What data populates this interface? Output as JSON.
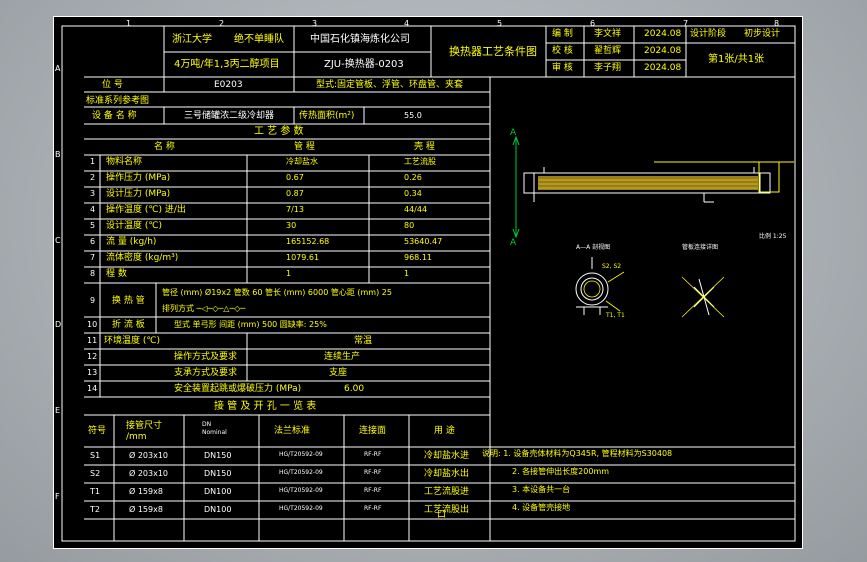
{
  "title_block": {
    "org": "浙江大学",
    "team": "绝不单睡队",
    "company": "中国石化镇海炼化公司",
    "project": "4万吨/年1,3丙二醇项目",
    "drawing_no": "ZJU-换热器-0203",
    "drawing_title": "换热器工艺条件图",
    "rows": [
      {
        "role": "编  制",
        "name": "李文祥",
        "date": "2024.08"
      },
      {
        "role": "校  核",
        "name": "翟哲辉",
        "date": "2024.08"
      },
      {
        "role": "审  核",
        "name": "李子翔",
        "date": "2024.08"
      }
    ],
    "stage_label": "设计阶段",
    "stage_value": "初步设计",
    "sheet_info": "第1张/共1张"
  },
  "equipment": {
    "tag_label": "位  号",
    "tag": "E0203",
    "type": "型式:固定管板、浮管、环盘管、夹套",
    "standard": "标准系列参考图",
    "name_label": "设 备 名 称",
    "name": "三号储罐浓二级冷却器",
    "area_label": "传热面积(m²)",
    "area": "55.0"
  },
  "process": {
    "title": "工 艺 参 数",
    "header": [
      "名  称",
      "管  程",
      "壳  程"
    ],
    "rows": [
      {
        "no": "1",
        "name": "物料名称",
        "tube": "冷却盐水",
        "shell": "工艺流股"
      },
      {
        "no": "2",
        "name": "操作压力 (MPa)",
        "tube": "0.67",
        "shell": "0.26"
      },
      {
        "no": "3",
        "name": "设计压力 (MPa)",
        "tube": "0.87",
        "shell": "0.34"
      },
      {
        "no": "4",
        "name": "操作温度 (℃)  进/出",
        "tube": "7/13",
        "shell": "44/44"
      },
      {
        "no": "5",
        "name": "设计温度 (℃)",
        "tube": "30",
        "shell": "80"
      },
      {
        "no": "6",
        "name": "流  量  (kg/h)",
        "tube": "165152.68",
        "shell": "53640.47"
      },
      {
        "no": "7",
        "name": "流体密度 (kg/m³)",
        "tube": "1079.61",
        "shell": "968.11"
      },
      {
        "no": "8",
        "name": "程  数",
        "tube": "1",
        "shell": "1"
      }
    ],
    "tube_row": {
      "no": "9",
      "name": "换 热 管",
      "spec": "管径 (mm)  Ø19x2   管数 60   管长 (mm) 6000   管心距 (mm) 25",
      "pattern": "排列方式  ─◁─◇─△─◇─"
    },
    "baffle_row": {
      "no": "10",
      "name": "折 流 板",
      "spec": "型式 单弓形      间距 (mm) 500      圆缺率: 25%"
    },
    "env_row": {
      "no": "11",
      "name": "环境温度 (℃)",
      "value": "常温"
    },
    "op_row": {
      "no": "12",
      "name": "操作方式及要求",
      "value": "连续生产"
    },
    "support_row": {
      "no": "13",
      "name": "支承方式及要求",
      "value": "支座"
    },
    "safety_row": {
      "no": "14",
      "name": "安全装置起跳或爆破压力 (MPa)",
      "value": "6.00"
    }
  },
  "nozzles": {
    "title": "接 管 及 开 孔 一 览 表",
    "header": [
      "符号",
      "接管尺寸\n/mm",
      "DN\nNominal",
      "法兰标准",
      "连接面",
      "用  途"
    ],
    "rows": [
      {
        "sym": "S1",
        "size": "Ø 203x10",
        "dn": "DN150",
        "std": "HG/T20592-09",
        "face": "RF-RF",
        "use": "冷却盐水进"
      },
      {
        "sym": "S2",
        "size": "Ø 203x10",
        "dn": "DN150",
        "std": "HG/T20592-09",
        "face": "RF-RF",
        "use": "冷却盐水出"
      },
      {
        "sym": "T1",
        "size": "Ø 159x8",
        "dn": "DN100",
        "std": "HG/T20592-09",
        "face": "RF-RF",
        "use": "工艺流股进"
      },
      {
        "sym": "T2",
        "size": "Ø 159x8",
        "dn": "DN100",
        "std": "HG/T20592-09",
        "face": "RF-RF",
        "use": "工艺流股出"
      }
    ],
    "extra": "口"
  },
  "notes": [
    "说明: 1. 设备壳体材料为Q345R, 管程材料为S30408",
    "2. 各接管伸出长度200mm",
    "3. 本设备共一台",
    "4. 设备管壳接地"
  ],
  "drawing": {
    "section_label": "A",
    "view_a": "A—A 剖视图",
    "view_b": "管板连接详图",
    "scale": "比例 1:25",
    "nozzle_s2": "S2, S2",
    "nozzle_t1": "T1, T1"
  },
  "border_numbers": [
    "1",
    "2",
    "3",
    "4",
    "5",
    "6",
    "7",
    "8"
  ],
  "border_letters": [
    "A",
    "B",
    "C",
    "D",
    "E",
    "F"
  ],
  "colors": {
    "line": "#ffffff",
    "text": "#ffffff",
    "accent": "#ffff00",
    "green": "#00cc33",
    "paper": "#000000",
    "desk": "#a9aeb3"
  }
}
